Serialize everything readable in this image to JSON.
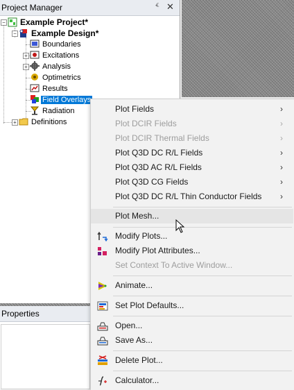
{
  "project_manager": {
    "title": "Project Manager",
    "pin_glyph": "ⱔ",
    "close_glyph": "✕",
    "tree": {
      "project": "Example Project*",
      "design": "Example Design*",
      "items": [
        "Boundaries",
        "Excitations",
        "Analysis",
        "Optimetrics",
        "Results",
        "Field Overlays",
        "Radiation"
      ],
      "definitions": "Definitions",
      "expander_plus": "+",
      "expander_minus": "−",
      "selected_item": "Field Overlays"
    }
  },
  "properties": {
    "title": "Properties"
  },
  "context_menu": {
    "submenu_arrow": "›",
    "items": [
      {
        "label": "Plot Fields",
        "enabled": true,
        "submenu": true
      },
      {
        "label": "Plot DCIR Fields",
        "enabled": false,
        "submenu": true
      },
      {
        "label": "Plot DCIR Thermal Fields",
        "enabled": false,
        "submenu": true
      },
      {
        "label": "Plot Q3D DC R/L Fields",
        "enabled": true,
        "submenu": true
      },
      {
        "label": "Plot Q3D AC R/L Fields",
        "enabled": true,
        "submenu": true
      },
      {
        "label": "Plot Q3D CG Fields",
        "enabled": true,
        "submenu": true
      },
      {
        "label": "Plot Q3D DC R/L Thin Conductor Fields",
        "enabled": true,
        "submenu": true
      },
      {
        "label": "Plot Mesh...",
        "enabled": true,
        "hovered": true
      },
      {
        "label": "Modify Plots...",
        "enabled": true,
        "icon": "modify-plots-icon"
      },
      {
        "label": "Modify Plot Attributes...",
        "enabled": true,
        "icon": "plot-attributes-icon"
      },
      {
        "label": "Set Context To Active Window...",
        "enabled": false
      },
      {
        "label": "Animate...",
        "enabled": true,
        "icon": "animate-icon"
      },
      {
        "label": "Set Plot Defaults...",
        "enabled": true,
        "icon": "plot-defaults-icon"
      },
      {
        "label": "Open...",
        "enabled": true,
        "icon": "open-icon"
      },
      {
        "label": "Save As...",
        "enabled": true,
        "icon": "save-as-icon"
      },
      {
        "label": "Delete Plot...",
        "enabled": true,
        "icon": "delete-plot-icon"
      },
      {
        "label": "Calculator...",
        "enabled": true,
        "icon": "calculator-icon"
      }
    ]
  },
  "colors": {
    "selection": "#0078d7",
    "menu_bg": "#f2f2f2",
    "disabled_text": "#9d9d9d"
  }
}
